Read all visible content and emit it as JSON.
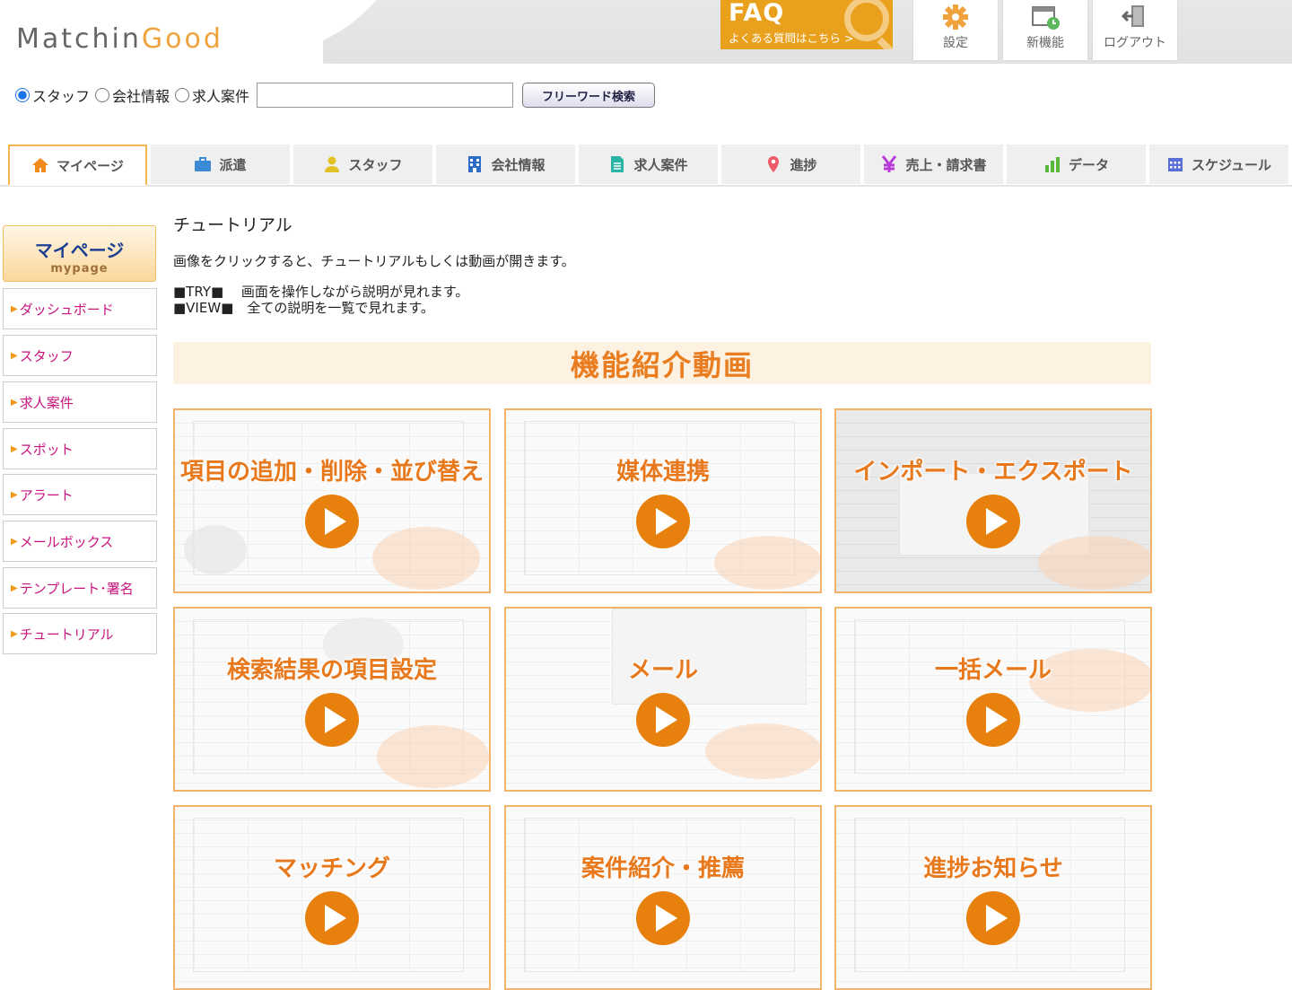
{
  "header": {
    "logo_part1": "Matchin",
    "logo_part2": "Good",
    "faq_title": "FAQ",
    "faq_sub": "よくある質問はこちら >",
    "buttons": [
      {
        "label": "設定",
        "icon": "gear-icon"
      },
      {
        "label": "新機能",
        "icon": "new-feature-icon"
      },
      {
        "label": "ログアウト",
        "icon": "logout-icon"
      }
    ]
  },
  "search": {
    "options": [
      "スタッフ",
      "会社情報",
      "求人案件"
    ],
    "selected": "スタッフ",
    "input_value": "",
    "button_label": "フリーワード検索"
  },
  "tabs": [
    {
      "label": "マイページ",
      "icon": "home-icon",
      "active": true
    },
    {
      "label": "派遣",
      "icon": "briefcase-icon"
    },
    {
      "label": "スタッフ",
      "icon": "person-icon"
    },
    {
      "label": "会社情報",
      "icon": "building-icon"
    },
    {
      "label": "求人案件",
      "icon": "document-icon"
    },
    {
      "label": "進捗",
      "icon": "pin-icon"
    },
    {
      "label": "売上・請求書",
      "icon": "yen-icon"
    },
    {
      "label": "データ",
      "icon": "bar-chart-icon"
    },
    {
      "label": "スケジュール",
      "icon": "calendar-icon"
    }
  ],
  "sidebar": {
    "title": "マイページ",
    "subtitle": "mypage",
    "items": [
      "ダッシュボード",
      "スタッフ",
      "求人案件",
      "スポット",
      "アラート",
      "メールボックス",
      "テンプレート･署名",
      "チュートリアル"
    ]
  },
  "main": {
    "title": "チュートリアル",
    "description": "画像をクリックすると、チュートリアルもしくは動画が開きます。",
    "try_line": "■TRY■　 画面を操作しながら説明が見れます。",
    "view_line": "■VIEW■　全ての説明を一覧で見れます。",
    "section_title": "機能紹介動画",
    "videos": [
      "項目の追加・削除・並び替え",
      "媒体連携",
      "インポート・エクスポート",
      "検索結果の項目設定",
      "メール",
      "一括メール",
      "マッチング",
      "案件紹介・推薦",
      "進捗お知らせ"
    ]
  },
  "colors": {
    "accent": "#e8800d",
    "faq_bg": "#e9a01c",
    "sidebar_text": "#c8137e",
    "tab_active_border": "#f5b74d",
    "banner_bg": "#fdf1e1"
  }
}
